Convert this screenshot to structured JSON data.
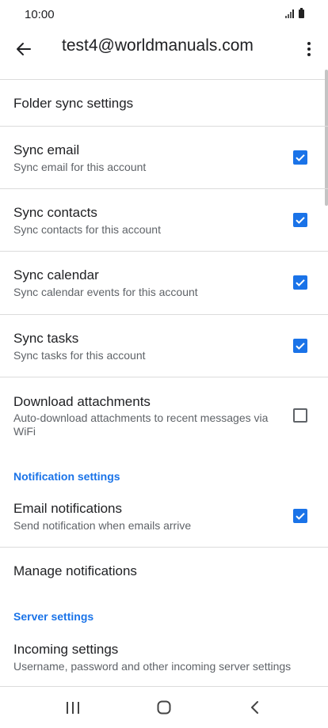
{
  "status_bar": {
    "time": "10:00"
  },
  "app_bar": {
    "title": "test4@worldmanuals.com"
  },
  "folder_sync": {
    "label": "Folder sync settings"
  },
  "settings": [
    {
      "title": "Sync email",
      "subtitle": "Sync email for this account",
      "checked": true
    },
    {
      "title": "Sync contacts",
      "subtitle": "Sync contacts for this account",
      "checked": true
    },
    {
      "title": "Sync calendar",
      "subtitle": "Sync calendar events for this account",
      "checked": true
    },
    {
      "title": "Sync tasks",
      "subtitle": "Sync tasks for this account",
      "checked": true
    },
    {
      "title": "Download attachments",
      "subtitle": "Auto-download attachments to recent messages via WiFi",
      "checked": false
    }
  ],
  "notification_section": {
    "header": "Notification settings"
  },
  "email_notifications": {
    "title": "Email notifications",
    "subtitle": "Send notification when emails arrive",
    "checked": true
  },
  "manage_notifications": {
    "label": "Manage notifications"
  },
  "server_section": {
    "header": "Server settings"
  },
  "incoming_settings": {
    "title": "Incoming settings",
    "subtitle": "Username, password and other incoming server settings"
  },
  "colors": {
    "accent": "#1a73e8",
    "text_primary": "#202124",
    "text_secondary": "#5f6368",
    "divider": "#dcdcdc"
  }
}
